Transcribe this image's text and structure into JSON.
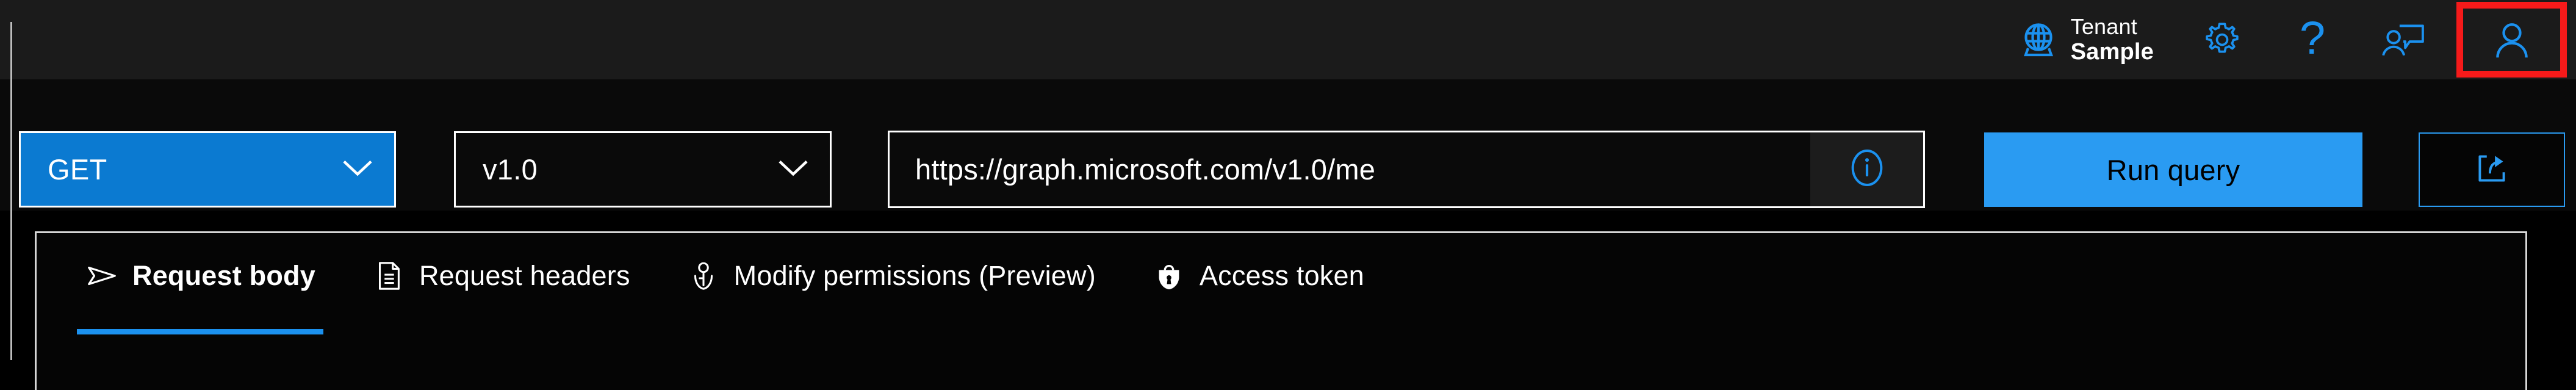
{
  "header": {
    "tenant": {
      "icon": "globe-icon",
      "label": "Tenant",
      "value": "Sample"
    },
    "actions": [
      {
        "name": "settings-icon",
        "label": "Settings"
      },
      {
        "name": "help-icon",
        "label": "?"
      },
      {
        "name": "feedback-icon",
        "label": "Feedback"
      },
      {
        "name": "profile-icon",
        "label": "Profile"
      }
    ],
    "highlight_color": "#f61a1a"
  },
  "querybar": {
    "method": {
      "value": "GET",
      "chevron": "chevron-down-icon",
      "accent": "#0b7ad1"
    },
    "version": {
      "value": "v1.0",
      "chevron": "chevron-down-icon"
    },
    "url": {
      "value": "https://graph.microsoft.com/v1.0/me",
      "placeholder": "https://graph.microsoft.com/v1.0/me",
      "info_icon": "info-icon"
    },
    "run_button": {
      "label": "Run query",
      "accent": "#2a9bf2"
    },
    "share_button": {
      "icon": "share-icon",
      "accent": "#2a9bf2"
    }
  },
  "tabs": {
    "active_index": 0,
    "underline_color": "#1b91ef",
    "items": [
      {
        "label": "Request body",
        "icon": "send-arrow-icon",
        "active": true
      },
      {
        "label": "Request headers",
        "icon": "document-lines-icon",
        "active": false
      },
      {
        "label": "Modify permissions (Preview)",
        "icon": "key-icon",
        "active": false
      },
      {
        "label": "Access token",
        "icon": "shield-lock-icon",
        "active": false
      }
    ]
  }
}
